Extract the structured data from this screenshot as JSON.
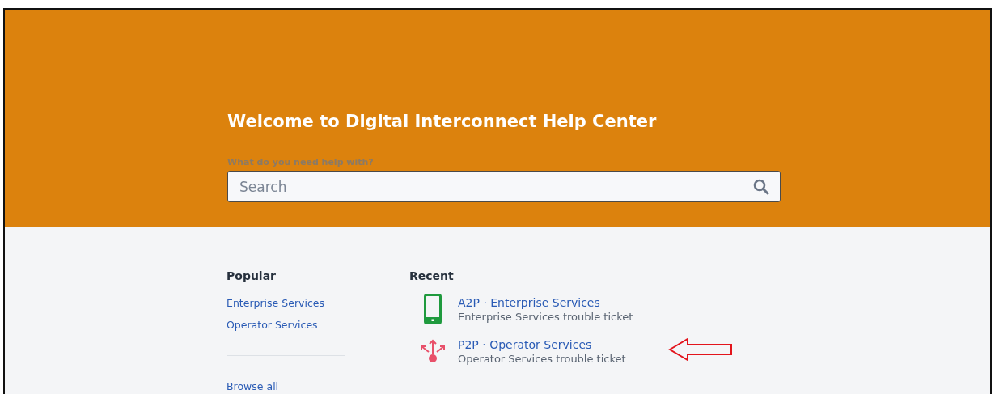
{
  "header": {
    "title": "Welcome to Digital Interconnect Help Center",
    "search_label": "What do you need help with?",
    "search": {
      "placeholder": "Search"
    }
  },
  "popular": {
    "heading": "Popular",
    "links": [
      "Enterprise Services",
      "Operator Services"
    ],
    "browse_all": "Browse all"
  },
  "recent": {
    "heading": "Recent",
    "items": [
      {
        "kind": "phone",
        "title": "A2P · Enterprise Services",
        "subtitle": "Enterprise Services trouble ticket",
        "highlighted": false
      },
      {
        "kind": "share",
        "title": "P2P · Operator Services",
        "subtitle": "Operator Services trouble ticket",
        "highlighted": true
      }
    ]
  }
}
